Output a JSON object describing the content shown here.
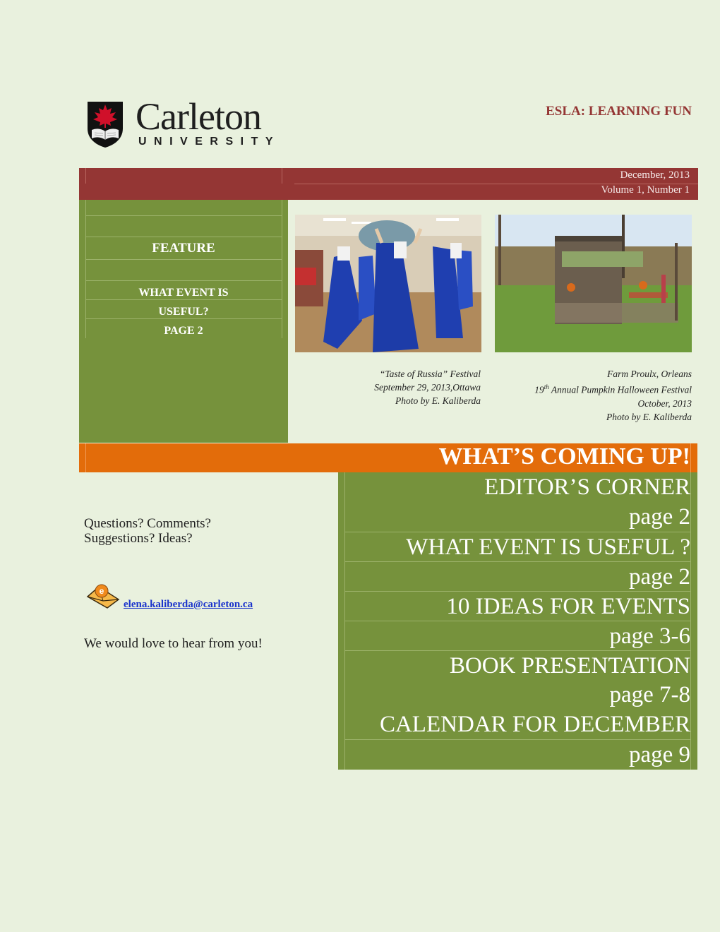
{
  "logo": {
    "wordmark": "Carleton",
    "subtitle": "UNIVERSITY"
  },
  "newsletter_title": "ESLA: LEARNING FUN",
  "header": {
    "date": "December, 2013",
    "volume": "Volume 1, Number 1",
    "color": "#943634"
  },
  "feature": {
    "label": "FEATURE",
    "link_lines": [
      "WHAT EVENT IS",
      "USEFUL?",
      "PAGE 2"
    ],
    "color": "#76923c"
  },
  "photos": [
    {
      "subject": "russian-folk-dancers",
      "caption": [
        "“Taste of Russia” Festival",
        "September 29, 2013,Ottawa",
        "Photo by E. Kaliberda"
      ]
    },
    {
      "subject": "pumpkin-farm-shack",
      "caption_line1": "Farm Proulx, Orleans",
      "caption_line2_num": "19",
      "caption_line2_sup": "th",
      "caption_line2_rest": " Annual Pumpkin Halloween Festival",
      "caption_line3": "October, 2013",
      "caption_line4": "Photo by E. Kaliberda"
    }
  ],
  "coming_up": {
    "title": "WHAT’S COMING UP!",
    "color": "#e36c0a"
  },
  "toc": [
    {
      "title": "EDITOR’S CORNER",
      "page": "page 2"
    },
    {
      "title": "WHAT EVENT IS USEFUL ?",
      "page": "page 2"
    },
    {
      "title": "10 IDEAS FOR EVENTS",
      "page": "page 3-6"
    },
    {
      "title": "BOOK PRESENTATION",
      "page": "page 7-8"
    },
    {
      "title": "CALENDAR FOR DECEMBER",
      "page": "page 9"
    }
  ],
  "contact": {
    "questions_line1": "Questions? Comments?",
    "questions_line2": "Suggestions? Ideas?",
    "email": "elena.kaliberda@carleton.ca",
    "closing": "We would love to hear from you!",
    "icon": "email-envelope-icon"
  }
}
